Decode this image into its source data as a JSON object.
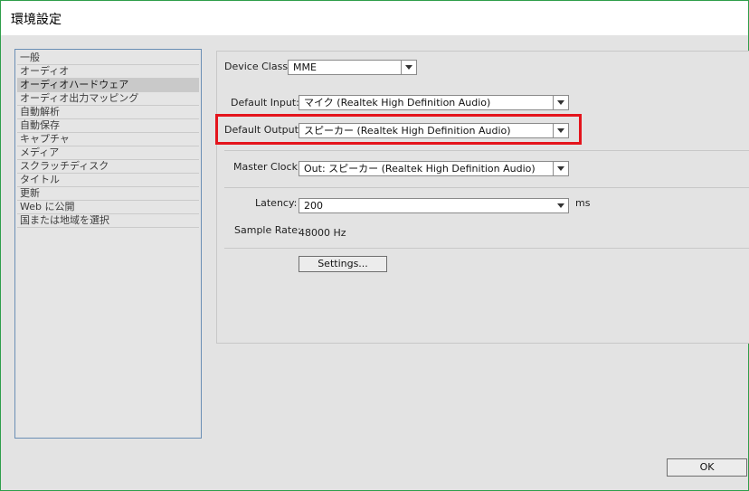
{
  "window": {
    "title": "環境設定"
  },
  "sidebar": {
    "items": [
      {
        "label": "一般"
      },
      {
        "label": "オーディオ"
      },
      {
        "label": "オーディオハードウェア",
        "selected": true
      },
      {
        "label": "オーディオ出力マッピング"
      },
      {
        "label": "自動解析"
      },
      {
        "label": "自動保存"
      },
      {
        "label": "キャプチャ"
      },
      {
        "label": "メディア"
      },
      {
        "label": "スクラッチディスク"
      },
      {
        "label": "タイトル"
      },
      {
        "label": "更新"
      },
      {
        "label": "Web に公開"
      },
      {
        "label": "国または地域を選択"
      }
    ]
  },
  "audio_hardware": {
    "device_class": {
      "label": "Device Class:",
      "value": "MME"
    },
    "default_input": {
      "label": "Default Input:",
      "value": "マイク (Realtek High Definition Audio)"
    },
    "default_output": {
      "label": "Default Output:",
      "value": "スピーカー (Realtek High Definition Audio)"
    },
    "master_clock": {
      "label": "Master Clock:",
      "value": "Out: スピーカー (Realtek High Definition Audio)"
    },
    "latency": {
      "label": "Latency:",
      "value": "200",
      "unit": "ms"
    },
    "sample_rate": {
      "label": "Sample Rate:",
      "value": "48000 Hz"
    },
    "settings_button": "Settings..."
  },
  "footer": {
    "ok_button": "OK"
  },
  "colors": {
    "highlight": "#e4141c",
    "sidebar_border": "#6b8fb5",
    "window_border": "#2f9e4a"
  }
}
